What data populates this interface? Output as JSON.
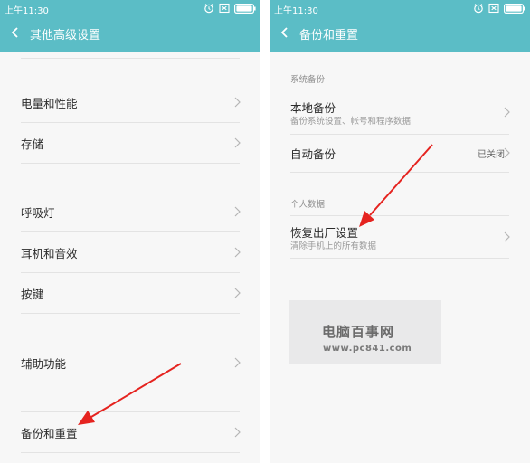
{
  "left": {
    "status_time": "上午11:30",
    "title": "其他高级设置",
    "items": [
      {
        "label": "电量和性能"
      },
      {
        "label": "存储"
      },
      {
        "label": "呼吸灯"
      },
      {
        "label": "耳机和音效"
      },
      {
        "label": "按键"
      },
      {
        "label": "辅助功能"
      },
      {
        "label": "备份和重置"
      }
    ]
  },
  "right": {
    "status_time": "上午11:30",
    "title": "备份和重置",
    "sections": [
      {
        "header": "系统备份",
        "items": [
          {
            "label": "本地备份",
            "sub": "备份系统设置、帐号和程序数据"
          },
          {
            "label": "自动备份",
            "value": "已关闭"
          }
        ]
      },
      {
        "header": "个人数据",
        "items": [
          {
            "label": "恢复出厂设置",
            "sub": "清除手机上的所有数据"
          }
        ]
      }
    ]
  },
  "watermark": {
    "name": "电脑百事网",
    "url": "www.pc841.com"
  },
  "colors": {
    "header": "#5bbdc6",
    "background": "#f7f7f7",
    "arrow": "#e5231f"
  }
}
